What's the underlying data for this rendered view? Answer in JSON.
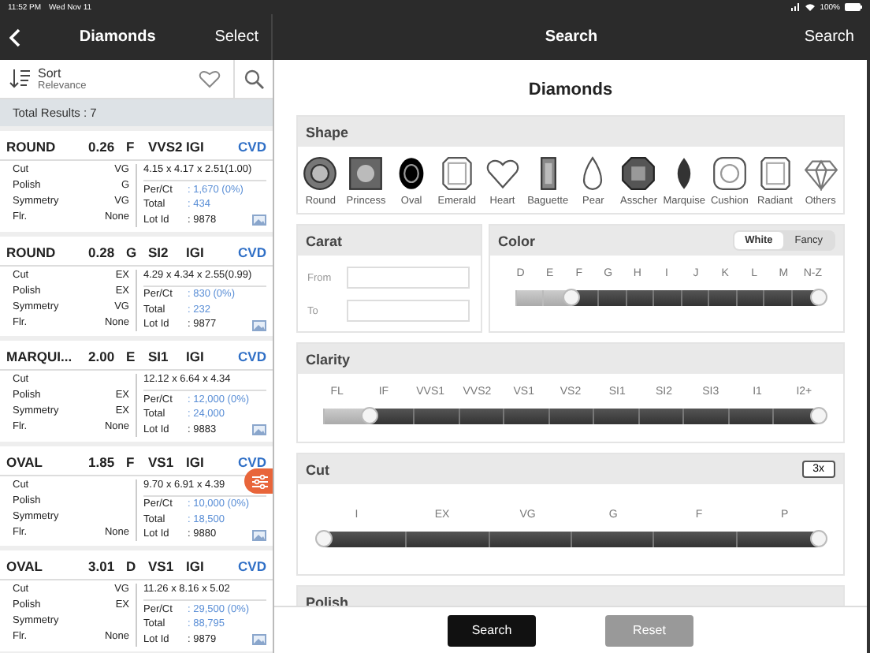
{
  "status_bar": {
    "time": "11:52 PM",
    "date": "Wed Nov 11",
    "battery": "100%"
  },
  "left_nav": {
    "title": "Diamonds",
    "action": "Select"
  },
  "sort": {
    "label": "Sort",
    "value": "Relevance"
  },
  "total_results": "Total Results : 7",
  "results": [
    {
      "shape": "ROUND",
      "carat": "0.26",
      "color_grade": "F",
      "clarity": "VVS2",
      "lab": "IGI",
      "type": "CVD",
      "measurements": "4.15 x 4.17 x 2.51(1.00)",
      "specs": [
        {
          "label": "Cut",
          "value": "VG"
        },
        {
          "label": "Polish",
          "value": "G"
        },
        {
          "label": "Symmetry",
          "value": "VG"
        },
        {
          "label": "Flr.",
          "value": "None"
        }
      ],
      "prices": [
        {
          "label": "Per/Ct",
          "value": ": 1,670 (0%)"
        },
        {
          "label": "Total",
          "value": ": 434"
        },
        {
          "label": "Lot Id",
          "value": ": 9878"
        }
      ]
    },
    {
      "shape": "ROUND",
      "carat": "0.28",
      "color_grade": "G",
      "clarity": "SI2",
      "lab": "IGI",
      "type": "CVD",
      "measurements": "4.29 x 4.34 x 2.55(0.99)",
      "specs": [
        {
          "label": "Cut",
          "value": "EX"
        },
        {
          "label": "Polish",
          "value": "EX"
        },
        {
          "label": "Symmetry",
          "value": "VG"
        },
        {
          "label": "Flr.",
          "value": "None"
        }
      ],
      "prices": [
        {
          "label": "Per/Ct",
          "value": ": 830 (0%)"
        },
        {
          "label": "Total",
          "value": ": 232"
        },
        {
          "label": "Lot Id",
          "value": ": 9877"
        }
      ]
    },
    {
      "shape": "MARQUI...",
      "carat": "2.00",
      "color_grade": "E",
      "clarity": "SI1",
      "lab": "IGI",
      "type": "CVD",
      "measurements": "12.12 x 6.64 x 4.34",
      "specs": [
        {
          "label": "Cut"
        },
        {
          "label": "Polish",
          "value": "EX"
        },
        {
          "label": "Symmetry",
          "value": "EX"
        },
        {
          "label": "Flr.",
          "value": "None"
        }
      ],
      "prices": [
        {
          "label": "Per/Ct",
          "value": ": 12,000 (0%)"
        },
        {
          "label": "Total",
          "value": ": 24,000"
        },
        {
          "label": "Lot Id",
          "value": ": 9883"
        }
      ]
    },
    {
      "shape": "OVAL",
      "carat": "1.85",
      "color_grade": "F",
      "clarity": "VS1",
      "lab": "IGI",
      "type": "CVD",
      "measurements": "9.70 x 6.91 x 4.39",
      "specs": [
        {
          "label": "Cut"
        },
        {
          "label": "Polish"
        },
        {
          "label": "Symmetry"
        },
        {
          "label": "Flr.",
          "value": "None"
        }
      ],
      "prices": [
        {
          "label": "Per/Ct",
          "value": ": 10,000 (0%)"
        },
        {
          "label": "Total",
          "value": ": 18,500"
        },
        {
          "label": "Lot Id",
          "value": ": 9880"
        }
      ]
    },
    {
      "shape": "OVAL",
      "carat": "3.01",
      "color_grade": "D",
      "clarity": "VS1",
      "lab": "IGI",
      "type": "CVD",
      "measurements": "11.26 x 8.16 x 5.02",
      "specs": [
        {
          "label": "Cut",
          "value": "VG"
        },
        {
          "label": "Polish",
          "value": "EX"
        },
        {
          "label": "Symmetry"
        },
        {
          "label": "Flr.",
          "value": "None"
        }
      ],
      "prices": [
        {
          "label": "Per/Ct",
          "value": ": 29,500 (0%)"
        },
        {
          "label": "Total",
          "value": ": 88,795"
        },
        {
          "label": "Lot Id",
          "value": ": 9879"
        }
      ]
    }
  ],
  "right_nav": {
    "title": "Search",
    "action": "Search"
  },
  "page_title": "Diamonds",
  "shape": {
    "title": "Shape",
    "items": [
      {
        "label": "Round",
        "kind": "round"
      },
      {
        "label": "Princess",
        "kind": "princess"
      },
      {
        "label": "Oval",
        "kind": "oval"
      },
      {
        "label": "Emerald",
        "kind": "emerald"
      },
      {
        "label": "Heart",
        "kind": "heart"
      },
      {
        "label": "Baguette",
        "kind": "baguette"
      },
      {
        "label": "Pear",
        "kind": "pear"
      },
      {
        "label": "Asscher",
        "kind": "asscher"
      },
      {
        "label": "Marquise",
        "kind": "marquise"
      },
      {
        "label": "Cushion",
        "kind": "cushion"
      },
      {
        "label": "Radiant",
        "kind": "radiant"
      },
      {
        "label": "Others",
        "kind": "others"
      }
    ]
  },
  "carat": {
    "title": "Carat",
    "from_label": "From",
    "to_label": "To"
  },
  "color": {
    "title": "Color",
    "toggle": [
      {
        "label": "White",
        "selected": true
      },
      {
        "label": "Fancy",
        "selected": false
      }
    ],
    "grades": [
      {
        "label": "D",
        "selected": false
      },
      {
        "label": "E",
        "selected": false
      },
      {
        "label": "F",
        "selected": true
      },
      {
        "label": "G",
        "selected": true
      },
      {
        "label": "H",
        "selected": true
      },
      {
        "label": "I",
        "selected": true
      },
      {
        "label": "J",
        "selected": true
      },
      {
        "label": "K",
        "selected": true
      },
      {
        "label": "L",
        "selected": true
      },
      {
        "label": "M",
        "selected": true
      },
      {
        "label": "N-Z",
        "selected": true
      }
    ]
  },
  "clarity": {
    "title": "Clarity",
    "grades": [
      {
        "label": "FL",
        "selected": false
      },
      {
        "label": "IF",
        "selected": true
      },
      {
        "label": "VVS1",
        "selected": true
      },
      {
        "label": "VVS2",
        "selected": true
      },
      {
        "label": "VS1",
        "selected": true
      },
      {
        "label": "VS2",
        "selected": true
      },
      {
        "label": "SI1",
        "selected": true
      },
      {
        "label": "SI2",
        "selected": true
      },
      {
        "label": "SI3",
        "selected": true
      },
      {
        "label": "I1",
        "selected": true
      },
      {
        "label": "I2+",
        "selected": true
      }
    ]
  },
  "cut": {
    "title": "Cut",
    "badge": "3x",
    "grades": [
      {
        "label": "I",
        "selected": true
      },
      {
        "label": "EX",
        "selected": true
      },
      {
        "label": "VG",
        "selected": true
      },
      {
        "label": "G",
        "selected": true
      },
      {
        "label": "F",
        "selected": true
      },
      {
        "label": "P",
        "selected": true
      }
    ]
  },
  "polish": {
    "title": "Polish"
  },
  "buttons": {
    "search": "Search",
    "reset": "Reset"
  }
}
